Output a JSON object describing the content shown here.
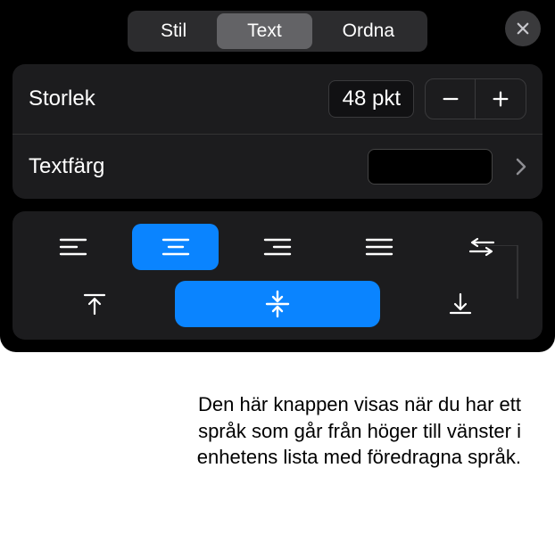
{
  "tabs": {
    "style": "Stil",
    "text": "Text",
    "arrange": "Ordna"
  },
  "size_row": {
    "label": "Storlek",
    "value": "48 pkt"
  },
  "color_row": {
    "label": "Textfärg",
    "swatch": "#000000"
  },
  "icons": {
    "close": "close-icon",
    "minus": "−",
    "plus": "+",
    "chevron": "chevron-right-icon"
  },
  "callout": "Den här knappen visas när du har ett språk som går från höger till vänster i enhetens lista med föredragna språk."
}
